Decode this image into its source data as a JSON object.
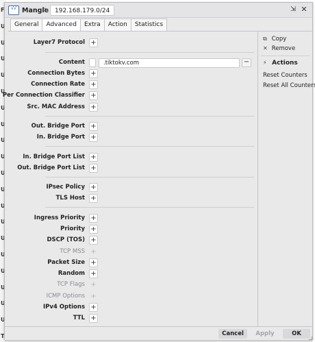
{
  "background": {
    "edge_letters": [
      "F",
      "U",
      "U",
      "U",
      "U",
      "U",
      "U",
      "U",
      "U",
      "U",
      "U",
      "U",
      "U",
      "U",
      "U",
      "U",
      "U",
      "U",
      "U",
      "U",
      "Th"
    ]
  },
  "window": {
    "title": "Mangle",
    "separator": ">",
    "address": "192.168.179.0/24",
    "restore_icon": "⇲",
    "close_icon": "✕",
    "logo_text": "√√\n∧"
  },
  "tabs": [
    "General",
    "Advanced",
    "Extra",
    "Action",
    "Statistics"
  ],
  "active_tab": "Advanced",
  "fields": {
    "layer7": "Layer7 Protocol",
    "content": "Content",
    "content_value": ".tiktokv.com",
    "connection_bytes": "Connection Bytes",
    "connection_rate": "Connection Rate",
    "per_connection_classifier": "Per Connection Classifier",
    "src_mac": "Src. MAC Address",
    "out_bridge_port": "Out. Bridge Port",
    "in_bridge_port": "In. Bridge Port",
    "in_bridge_port_list": "In. Bridge Port List",
    "out_bridge_port_list": "Out. Bridge Port List",
    "ipsec_policy": "IPsec Policy",
    "tls_host": "TLS Host",
    "ingress_priority": "Ingress Priority",
    "priority": "Priority",
    "dscp": "DSCP (TOS)",
    "tcp_mss": "TCP MSS",
    "packet_size": "Packet Size",
    "random": "Random",
    "tcp_flags": "TCP Flags",
    "icmp_options": "ICMP Options",
    "ipv4_options": "IPv4 Options",
    "ttl": "TTL"
  },
  "plus_symbol": "+",
  "minus_symbol": "−",
  "sidebar": {
    "copy": "Copy",
    "remove": "Remove",
    "actions": "Actions",
    "reset_counters": "Reset Counters",
    "reset_all_counters": "Reset All Counters",
    "copy_icon": "⧉",
    "remove_icon": "✕",
    "actions_icon": "⚡"
  },
  "footer": {
    "cancel": "Cancel",
    "apply": "Apply",
    "ok": "OK"
  }
}
